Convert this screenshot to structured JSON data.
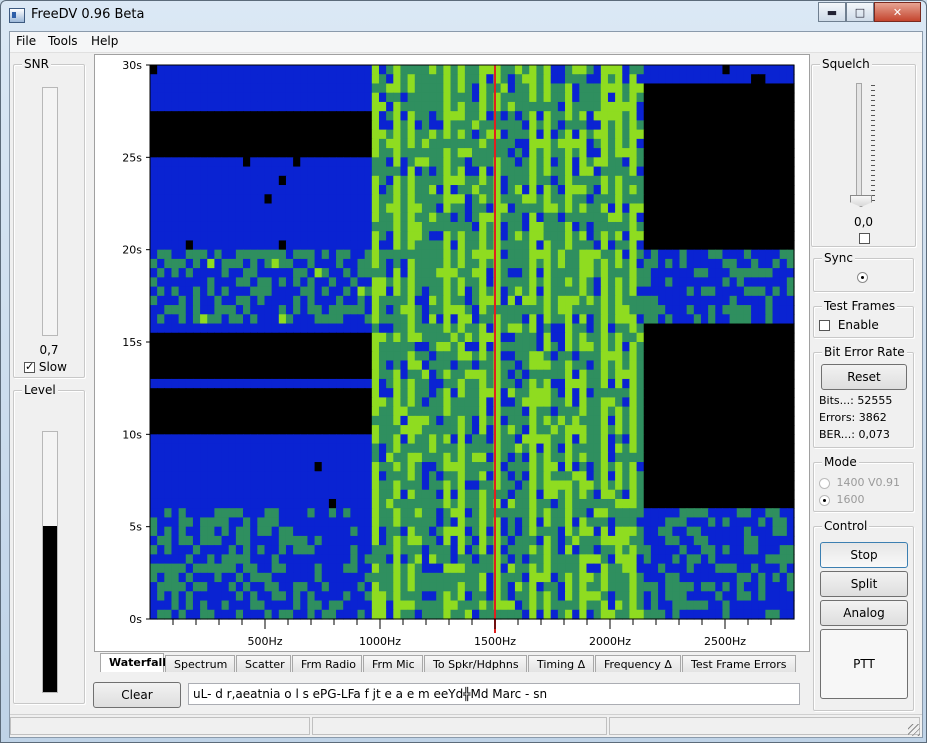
{
  "window": {
    "title": "FreeDV 0.96 Beta",
    "controls": {
      "minimize": "▬",
      "maximize": "□",
      "close": "✕"
    }
  },
  "menu": {
    "items": [
      {
        "label": "File"
      },
      {
        "label": "Tools"
      },
      {
        "label": "Help"
      }
    ]
  },
  "snr": {
    "group_label": "SNR",
    "value": "0,7",
    "slow_label": "Slow",
    "slow_checked": true,
    "bar_fill": 0
  },
  "level": {
    "group_label": "Level",
    "bar_fill": 0.64
  },
  "waterfall": {
    "y_ticks": [
      "0s",
      "5s",
      "10s",
      "15s",
      "20s",
      "25s",
      "30s"
    ],
    "x_ticks": [
      "500Hz",
      "1000Hz",
      "1500Hz",
      "2000Hz",
      "2500Hz"
    ],
    "freq_range_hz": [
      0,
      2800
    ],
    "time_range_s": [
      0,
      30
    ],
    "marker_hz": 1500,
    "signal_band_hz": [
      950,
      2150
    ],
    "colors": {
      "background": "#000000",
      "low": "#0a23d2",
      "mid": "#2f8f5f",
      "high": "#8fdc20",
      "marker": "#e02020"
    }
  },
  "tabs": [
    {
      "label": "Waterfall",
      "active": true
    },
    {
      "label": "Spectrum"
    },
    {
      "label": "Scatter"
    },
    {
      "label": "Frm Radio"
    },
    {
      "label": "Frm Mic"
    },
    {
      "label": "To Spkr/Hdphns"
    },
    {
      "label": "Timing Δ"
    },
    {
      "label": "Frequency Δ"
    },
    {
      "label": "Test Frame Errors"
    }
  ],
  "bottom": {
    "clear_label": "Clear",
    "text": "uL- d r,aeatnia  o  l  s  ePG-LFa f jt e a e m  eeYd╬Md Marc -  sn"
  },
  "squelch": {
    "group_label": "Squelch",
    "value": "0,0",
    "enabled": false,
    "slider_level": 0
  },
  "sync": {
    "group_label": "Sync",
    "locked": true
  },
  "test_frames": {
    "group_label": "Test Frames",
    "enable_label": "Enable",
    "checked": false
  },
  "ber": {
    "group_label": "Bit Error Rate",
    "reset_label": "Reset",
    "bits": "Bits...: 52555",
    "errors": "Errors: 3862",
    "ber": "BER...: 0,073"
  },
  "mode": {
    "group_label": "Mode",
    "options": [
      {
        "label": "1400 V0.91",
        "selected": false
      },
      {
        "label": "1600",
        "selected": true
      }
    ]
  },
  "control": {
    "group_label": "Control",
    "stop_label": "Stop",
    "split_label": "Split",
    "analog_label": "Analog",
    "ptt_label": "PTT"
  }
}
